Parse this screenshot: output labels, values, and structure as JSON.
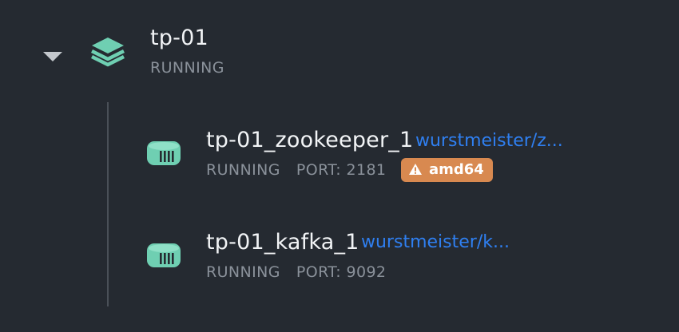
{
  "group": {
    "name": "tp-01",
    "status": "RUNNING",
    "toggle_icon": "caret-down-icon",
    "icon": "stack-layers-icon"
  },
  "containers": [
    {
      "name": "tp-01_zookeeper_1",
      "image": "wurstmeister/z...",
      "status": "RUNNING",
      "port": "PORT: 2181",
      "badge": "amd64",
      "badge_icon": "warning-icon",
      "icon": "container-icon"
    },
    {
      "name": "tp-01_kafka_1",
      "image": "wurstmeister/k...",
      "status": "RUNNING",
      "port": "PORT: 9092",
      "icon": "container-icon"
    }
  ],
  "colors": {
    "background": "#252a31",
    "icon_green": "#6fcfb2",
    "link_blue": "#2f7ff0",
    "badge_orange": "#d88950",
    "muted_text": "#8a919a"
  }
}
